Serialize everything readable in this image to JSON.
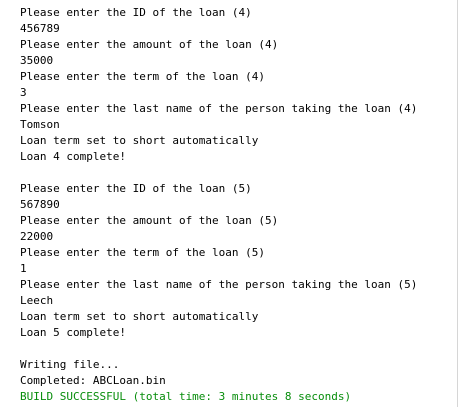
{
  "console": {
    "colors": {
      "text": "#000000",
      "success": "#078d0b",
      "background": "#ffffff"
    },
    "lines": [
      {
        "text": "Please enter the ID of the loan (4)",
        "kind": "prompt"
      },
      {
        "text": "456789",
        "kind": "input"
      },
      {
        "text": "Please enter the amount of the loan (4)",
        "kind": "prompt"
      },
      {
        "text": "35000",
        "kind": "input"
      },
      {
        "text": "Please enter the term of the loan (4)",
        "kind": "prompt"
      },
      {
        "text": "3",
        "kind": "input"
      },
      {
        "text": "Please enter the last name of the person taking the loan (4)",
        "kind": "prompt"
      },
      {
        "text": "Tomson",
        "kind": "input"
      },
      {
        "text": "Loan term set to short automatically",
        "kind": "message"
      },
      {
        "text": "Loan 4 complete!",
        "kind": "message"
      },
      {
        "text": "",
        "kind": "blank"
      },
      {
        "text": "Please enter the ID of the loan (5)",
        "kind": "prompt"
      },
      {
        "text": "567890",
        "kind": "input"
      },
      {
        "text": "Please enter the amount of the loan (5)",
        "kind": "prompt"
      },
      {
        "text": "22000",
        "kind": "input"
      },
      {
        "text": "Please enter the term of the loan (5)",
        "kind": "prompt"
      },
      {
        "text": "1",
        "kind": "input"
      },
      {
        "text": "Please enter the last name of the person taking the loan (5)",
        "kind": "prompt"
      },
      {
        "text": "Leech",
        "kind": "input"
      },
      {
        "text": "Loan term set to short automatically",
        "kind": "message"
      },
      {
        "text": "Loan 5 complete!",
        "kind": "message"
      },
      {
        "text": "",
        "kind": "blank"
      },
      {
        "text": "Writing file...",
        "kind": "message"
      },
      {
        "text": "Completed: ABCLoan.bin",
        "kind": "message"
      },
      {
        "text": "BUILD SUCCESSFUL (total time: 3 minutes 8 seconds)",
        "kind": "success"
      }
    ]
  }
}
